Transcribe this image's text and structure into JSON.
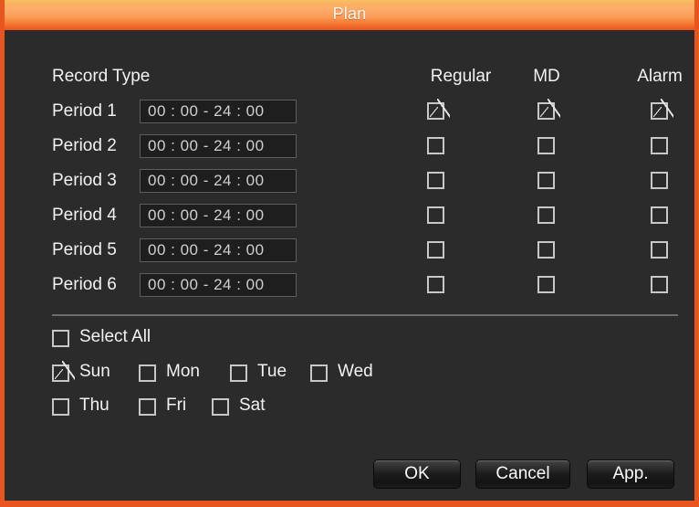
{
  "window": {
    "title": "Plan",
    "accent_color": "#e8551f",
    "titlebar_gradient_top": "#f7c15f",
    "titlebar_gradient_bottom": "#e8551f",
    "background_color": "#2b2b2b"
  },
  "table": {
    "row_header_label": "Record Type",
    "columns": [
      "Regular",
      "MD",
      "Alarm"
    ],
    "rows": [
      {
        "label": "Period 1",
        "time": "00 : 00 - 24 : 00",
        "checks": [
          true,
          true,
          true
        ]
      },
      {
        "label": "Period 2",
        "time": "00 : 00 - 24 : 00",
        "checks": [
          false,
          false,
          false
        ]
      },
      {
        "label": "Period 3",
        "time": "00 : 00 - 24 : 00",
        "checks": [
          false,
          false,
          false
        ]
      },
      {
        "label": "Period 4",
        "time": "00 : 00 - 24 : 00",
        "checks": [
          false,
          false,
          false
        ]
      },
      {
        "label": "Period 5",
        "time": "00 : 00 - 24 : 00",
        "checks": [
          false,
          false,
          false
        ]
      },
      {
        "label": "Period 6",
        "time": "00 : 00 - 24 : 00",
        "checks": [
          false,
          false,
          false
        ]
      }
    ]
  },
  "days": {
    "select_all": {
      "label": "Select All",
      "checked": false
    },
    "items": [
      {
        "label": "Sun",
        "checked": true
      },
      {
        "label": "Mon",
        "checked": false
      },
      {
        "label": "Tue",
        "checked": false
      },
      {
        "label": "Wed",
        "checked": false
      },
      {
        "label": "Thu",
        "checked": false
      },
      {
        "label": "Fri",
        "checked": false
      },
      {
        "label": "Sat",
        "checked": false
      }
    ]
  },
  "buttons": [
    {
      "label": "OK"
    },
    {
      "label": "Cancel"
    },
    {
      "label": "App."
    }
  ]
}
